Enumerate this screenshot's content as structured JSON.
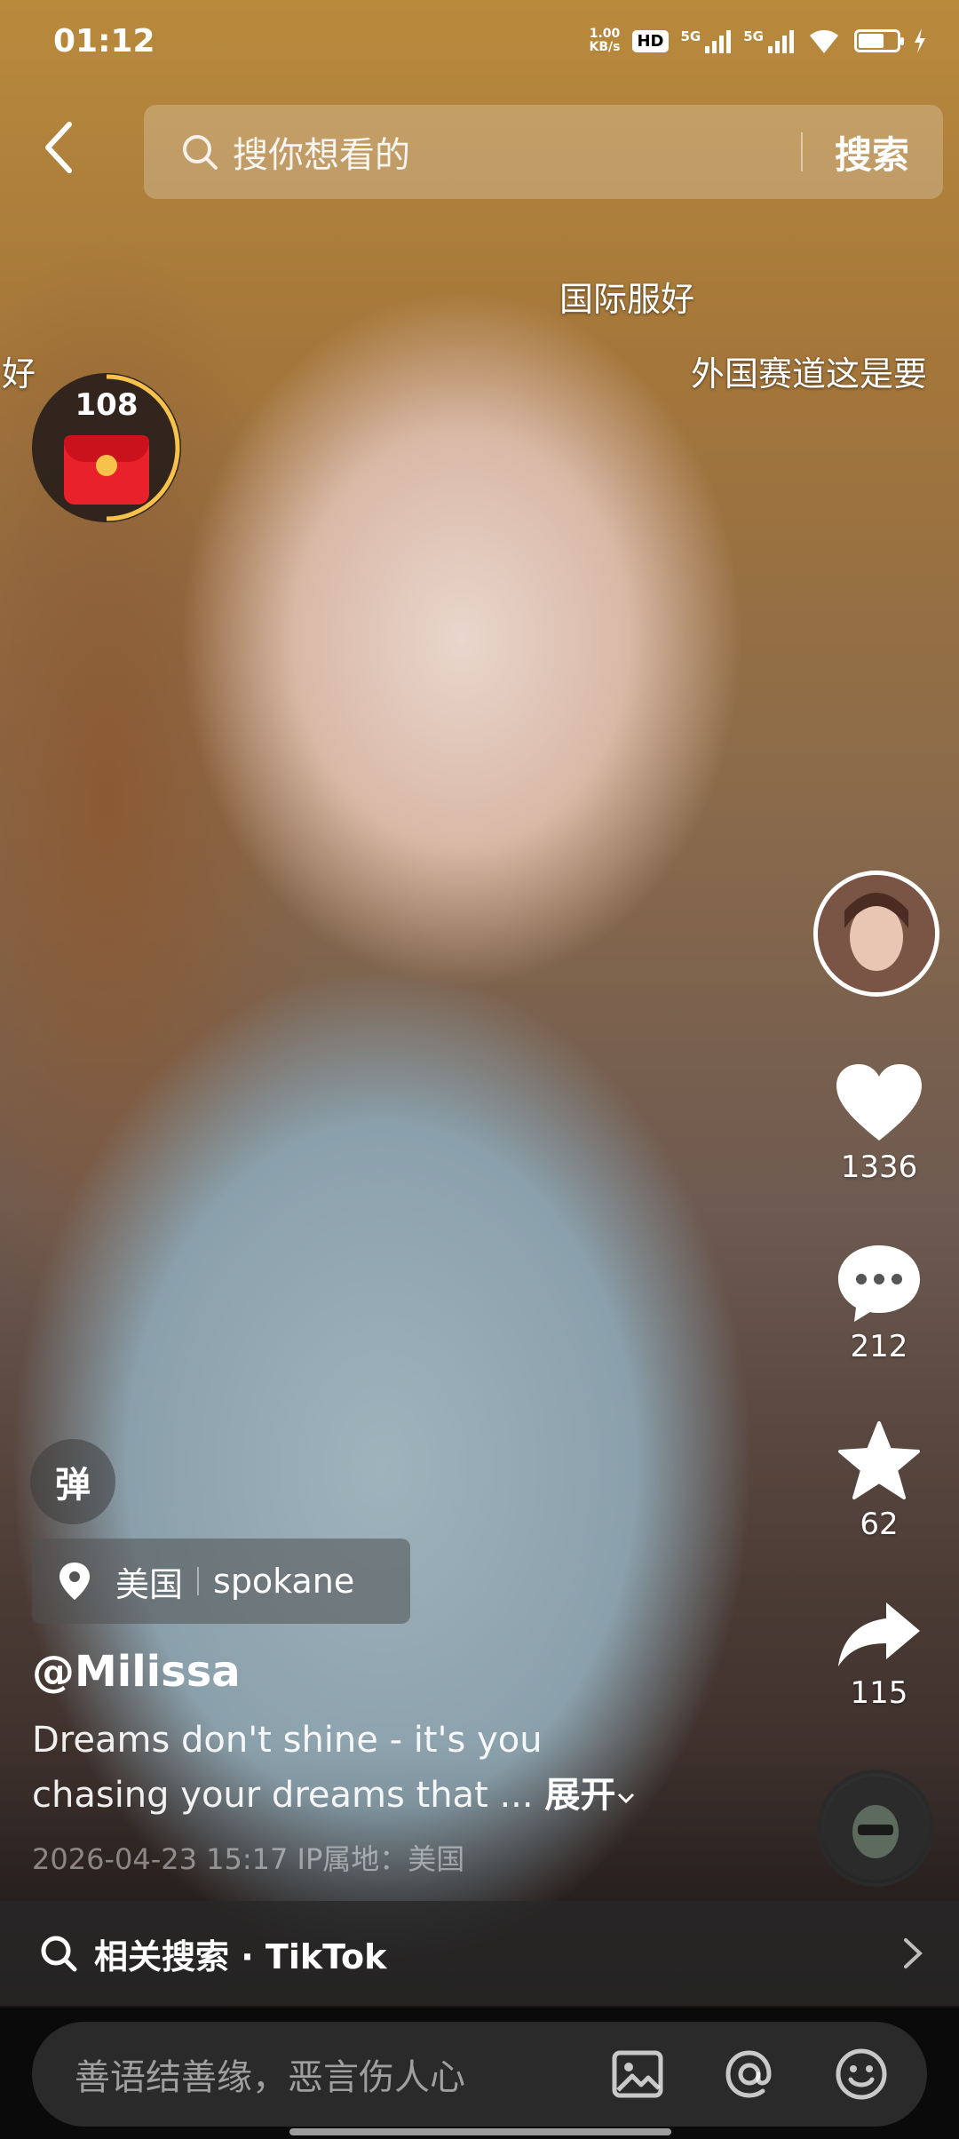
{
  "status_bar": {
    "time": "01:12",
    "net_speed_value": "1.00",
    "net_speed_unit": "KB/s",
    "hd_label": "HD",
    "signal1_label": "5G",
    "signal2_label": "5G"
  },
  "search": {
    "placeholder": "搜你想看的",
    "button_label": "搜索"
  },
  "danmaku": [
    {
      "text": "国际服好"
    },
    {
      "text": "好"
    },
    {
      "text": "外国赛道这是要"
    }
  ],
  "red_packet": {
    "count": "108"
  },
  "right_rail": {
    "likes": "1336",
    "comments": "212",
    "favorites": "62",
    "shares": "115"
  },
  "post": {
    "danmu_toggle_label": "弹",
    "location_country": "美国",
    "location_city": "spokane",
    "username": "@Milissa",
    "caption": "Dreams don't shine - it's you chasing your dreams that ...",
    "expand_label": "展开",
    "meta": "2026-04-23 15:17  IP属地：美国"
  },
  "related_search": {
    "label": "相关搜索 · TikTok"
  },
  "comment_bar": {
    "placeholder": "善语结善缘，恶言伤人心"
  },
  "colors": {
    "accent_gold": "#f6c24a",
    "red_packet": "#e8212a"
  }
}
